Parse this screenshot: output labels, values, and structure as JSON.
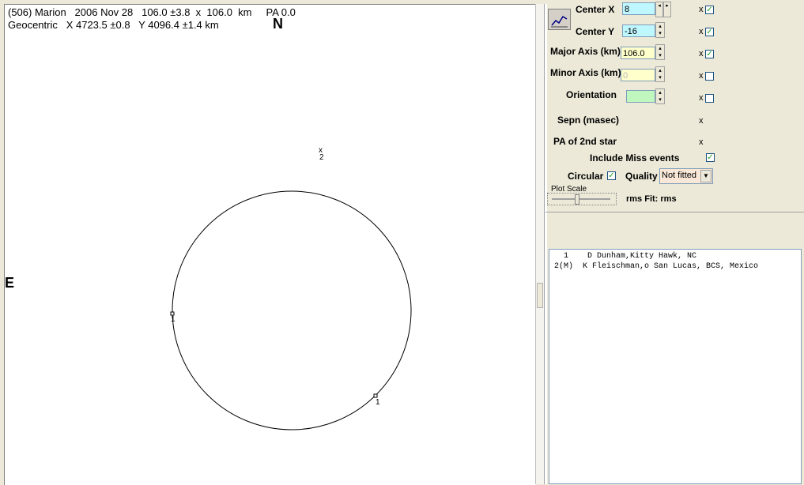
{
  "header": {
    "line1": "(506) Marion   2006 Nov 28   106.0 ±3.8  x  106.0  km     PA 0.0",
    "line2": "Geocentric   X 4723.5 ±0.8   Y 4096.4 ±1.4 km"
  },
  "compass": {
    "north": "N",
    "east": "E"
  },
  "plot_markers": {
    "top_x": "x",
    "top_num": "2",
    "left_num": "1",
    "bottom_num": "1"
  },
  "controls": {
    "center_x": {
      "label": "Center X",
      "value": "8"
    },
    "center_y": {
      "label": "Center Y",
      "value": "-16"
    },
    "major_axis": {
      "label": "Major Axis (km)",
      "value": "106.0"
    },
    "minor_axis": {
      "label": "Minor Axis (km)",
      "value": "0"
    },
    "orientation": {
      "label": "Orientation",
      "value": ""
    },
    "sepn": {
      "label": "Sepn (masec)"
    },
    "pa2": {
      "label": "PA of 2nd star"
    },
    "x_mark": "x",
    "include_miss": "Include Miss events",
    "circular": "Circular",
    "quality_label": "Quality",
    "quality_value": "Not fitted",
    "plot_scale": "Plot Scale",
    "rms_fit": "rms Fit: rms"
  },
  "observers": [
    "  1    D Dunham,Kitty Hawk, NC",
    "2(M)  K Fleischman,o San Lucas, BCS, Mexico"
  ],
  "colors": {
    "cyan_field": "#bff7ff",
    "yellow_field": "#ffffcc",
    "green_field": "#bff7bf",
    "quality_field": "#f9e8d8"
  }
}
